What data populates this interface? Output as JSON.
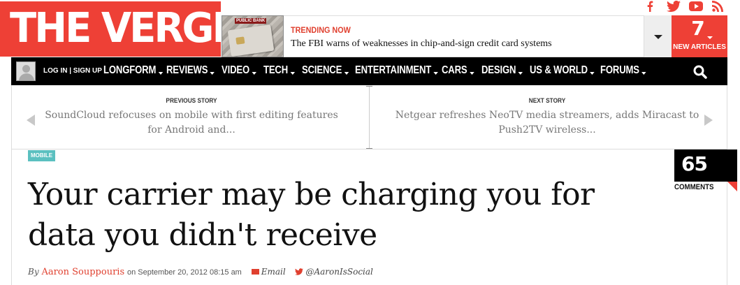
{
  "brand": {
    "logo_text": "THE VERGE",
    "accent": "#ee4036"
  },
  "social": {
    "icons": [
      "facebook-icon",
      "twitter-icon",
      "youtube-icon",
      "rss-icon"
    ]
  },
  "trending": {
    "thumb_label": "PUBLIC BANK",
    "label": "TRENDING NOW",
    "headline": "The FBI warns of weaknesses in chip-and-sign credit card systems"
  },
  "new_articles": {
    "count": "7",
    "label": "NEW ARTICLES"
  },
  "nav": {
    "login": "LOG IN | SIGN UP",
    "items": [
      "LONGFORM",
      "REVIEWS",
      "VIDEO",
      "TECH",
      "SCIENCE",
      "ENTERTAINMENT",
      "CARS",
      "DESIGN",
      "US & WORLD",
      "FORUMS"
    ]
  },
  "prev_story": {
    "label": "PREVIOUS STORY",
    "title_line1": "SoundCloud refocuses on mobile with first editing features",
    "title_line2": "for Android and..."
  },
  "next_story": {
    "label": "NEXT STORY",
    "title_line1": "Netgear refreshes NeoTV media streamers, adds Miracast to",
    "title_line2": "Push2TV wireless..."
  },
  "article": {
    "category": "MOBILE",
    "headline_line1": "Your carrier may be charging you for",
    "headline_line2": "data you didn't receive",
    "by": "By",
    "author": "Aaron Souppouris",
    "date": "on September 20, 2012 08:15 am",
    "email": "Email",
    "twitter": "@AaronIsSocial"
  },
  "comments": {
    "count": "65",
    "label": "COMMENTS"
  }
}
